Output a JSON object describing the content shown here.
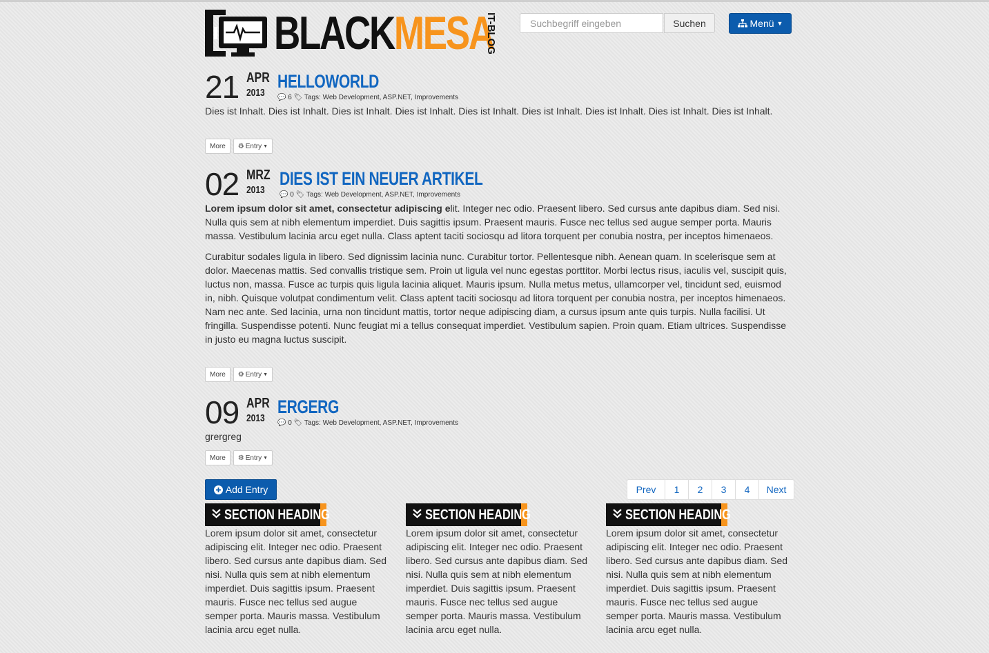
{
  "brand": {
    "name_part1": "BLACK",
    "name_part2": "MESA",
    "tagline": "IT-BLOG",
    "colors": {
      "black": "#111111",
      "orange": "#f7941d",
      "blue": "#0c5cad",
      "link": "#1166c0"
    }
  },
  "search": {
    "placeholder": "Suchbegriff eingeben",
    "button_label": "Suchen"
  },
  "menu": {
    "label": "Menü",
    "icon": "sitemap-icon"
  },
  "posts": [
    {
      "day": "21",
      "month": "APR",
      "year": "2013",
      "title": "HELLOWORLD",
      "comments": "6",
      "tags_label": "Tags:",
      "tags": "Web Development, ASP.NET, Improvements",
      "body_text": "Dies ist Inhalt. Dies ist Inhalt. Dies ist Inhalt. Dies ist Inhalt. Dies ist Inhalt. Dies ist Inhalt. Dies ist Inhalt. Dies ist Inhalt. Dies ist Inhalt."
    },
    {
      "day": "02",
      "month": "MRZ",
      "year": "2013",
      "title": "DIES IST EIN NEUER ARTIKEL",
      "comments": "0",
      "tags_label": "Tags:",
      "tags": "Web Development, ASP.NET, Improvements",
      "body_bold": "Lorem ipsum dolor sit amet, consectetur adipiscing e",
      "body_rest": "lit. Integer nec odio. Praesent libero. Sed cursus ante dapibus diam. Sed nisi. Nulla quis sem at nibh elementum imperdiet. Duis sagittis ipsum. Praesent mauris. Fusce nec tellus sed augue semper porta. Mauris massa. Vestibulum lacinia arcu eget nulla. Class aptent taciti sociosqu ad litora torquent per conubia nostra, per inceptos himenaeos.",
      "body_p2": "Curabitur sodales ligula in libero. Sed dignissim lacinia nunc. Curabitur tortor. Pellentesque nibh. Aenean quam. In scelerisque sem at dolor. Maecenas mattis. Sed convallis tristique sem. Proin ut ligula vel nunc egestas porttitor. Morbi lectus risus, iaculis vel, suscipit quis, luctus non, massa. Fusce ac turpis quis ligula lacinia aliquet. Mauris ipsum. Nulla metus metus, ullamcorper vel, tincidunt sed, euismod in, nibh. Quisque volutpat condimentum velit. Class aptent taciti sociosqu ad litora torquent per conubia nostra, per inceptos himenaeos. Nam nec ante. Sed lacinia, urna non tincidunt mattis, tortor neque adipiscing diam, a cursus ipsum ante quis turpis. Nulla facilisi. Ut fringilla. Suspendisse potenti. Nunc feugiat mi a tellus consequat imperdiet. Vestibulum sapien. Proin quam. Etiam ultrices. Suspendisse in justo eu magna luctus suscipit."
    },
    {
      "day": "09",
      "month": "APR",
      "year": "2013",
      "title": "ERGERG",
      "comments": "0",
      "tags_label": "Tags:",
      "tags": "Web Development, ASP.NET, Improvements",
      "body_text": "grergreg"
    }
  ],
  "post_buttons": {
    "more": "More",
    "entry": "Entry"
  },
  "add_entry": {
    "label": "Add Entry"
  },
  "pagination": {
    "prev": "Prev",
    "pages": [
      "1",
      "2",
      "3",
      "4"
    ],
    "next": "Next"
  },
  "sections": [
    {
      "heading": "SECTION HEADING",
      "text": "Lorem ipsum dolor sit amet, consectetur adipiscing elit. Integer nec odio. Praesent libero. Sed cursus ante dapibus diam. Sed nisi. Nulla quis sem at nibh elementum imperdiet. Duis sagittis ipsum. Praesent mauris. Fusce nec tellus sed augue semper porta. Mauris massa. Vestibulum lacinia arcu eget nulla."
    },
    {
      "heading": "SECTION HEADING",
      "text": "Lorem ipsum dolor sit amet, consectetur adipiscing elit. Integer nec odio. Praesent libero. Sed cursus ante dapibus diam. Sed nisi. Nulla quis sem at nibh elementum imperdiet. Duis sagittis ipsum. Praesent mauris. Fusce nec tellus sed augue semper porta. Mauris massa. Vestibulum lacinia arcu eget nulla."
    },
    {
      "heading": "SECTION HEADING",
      "text": "Lorem ipsum dolor sit amet, consectetur adipiscing elit. Integer nec odio. Praesent libero. Sed cursus ante dapibus diam. Sed nisi. Nulla quis sem at nibh elementum imperdiet. Duis sagittis ipsum. Praesent mauris. Fusce nec tellus sed augue semper porta. Mauris massa. Vestibulum lacinia arcu eget nulla."
    }
  ]
}
